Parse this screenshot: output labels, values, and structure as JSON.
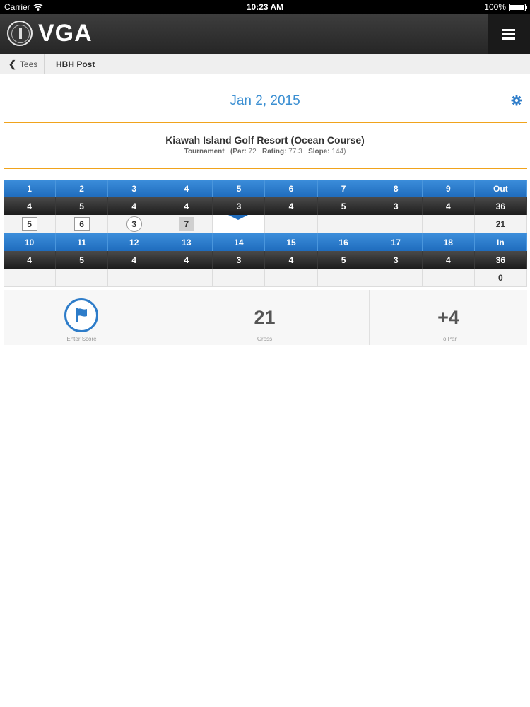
{
  "status_bar": {
    "carrier": "Carrier",
    "time": "10:23 AM",
    "battery": "100%"
  },
  "header": {
    "brand": "VGA",
    "menu_icon": "hamburger-icon"
  },
  "breadcrumb": {
    "back_label": "Tees",
    "current": "HBH Post"
  },
  "round": {
    "date": "Jan 2, 2015"
  },
  "course": {
    "name": "Kiawah Island Golf Resort (Ocean Course)",
    "tee": "Tournament",
    "par_label": "(Par:",
    "par": "72",
    "rating_label": "Rating:",
    "rating": "77.3",
    "slope_label": "Slope:",
    "slope": "144)"
  },
  "scorecard": {
    "front": {
      "holes": [
        "1",
        "2",
        "3",
        "4",
        "5",
        "6",
        "7",
        "8",
        "9",
        "Out"
      ],
      "pars": [
        "4",
        "5",
        "4",
        "4",
        "3",
        "4",
        "5",
        "3",
        "4",
        "36"
      ],
      "scores": [
        "5",
        "6",
        "3",
        "7",
        "",
        "",
        "",
        "",
        "",
        "21"
      ]
    },
    "back": {
      "holes": [
        "10",
        "11",
        "12",
        "13",
        "14",
        "15",
        "16",
        "17",
        "18",
        "In"
      ],
      "pars": [
        "4",
        "5",
        "4",
        "4",
        "3",
        "4",
        "5",
        "3",
        "4",
        "36"
      ],
      "scores": [
        "",
        "",
        "",
        "",
        "",
        "",
        "",
        "",
        "",
        "0"
      ]
    }
  },
  "summary": {
    "enter_score_label": "Enter Score",
    "gross": "21",
    "gross_label": "Gross",
    "to_par": "+4",
    "to_par_label": "To Par"
  },
  "colors": {
    "accent_blue": "#3b8fd2",
    "divider_orange": "#f0a31c",
    "header_dark": "#2e2e2e"
  }
}
